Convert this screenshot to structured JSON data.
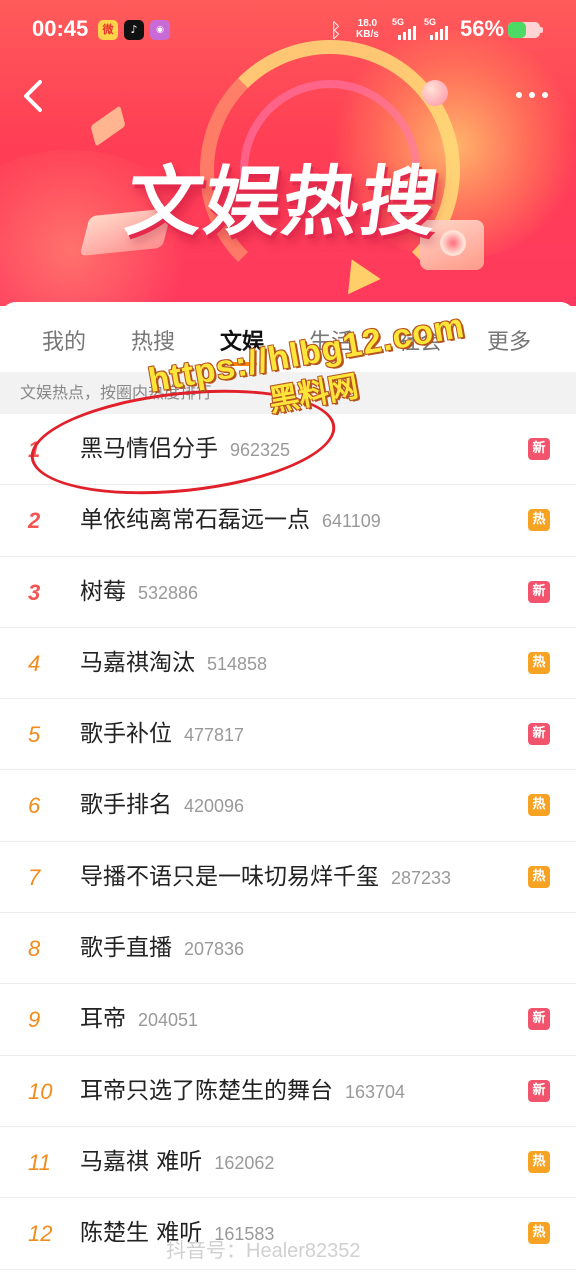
{
  "status_bar": {
    "time": "00:45",
    "apps": [
      "weibo",
      "tiktok",
      "other"
    ],
    "net_speed_value": "18.0",
    "net_speed_unit": "KB/s",
    "signal1_label": "5G",
    "signal2_label": "5G",
    "battery_percent": "56%",
    "battery_level": 0.56,
    "colors": {
      "battery_fill": "#4cd964"
    }
  },
  "header": {
    "title": "文娱热搜"
  },
  "tabs": [
    {
      "label": "我的"
    },
    {
      "label": "热搜"
    },
    {
      "label": "文娱",
      "active": true
    },
    {
      "label": "生活"
    },
    {
      "label": "社会"
    },
    {
      "label": "更多"
    }
  ],
  "notice": "文娱热点，按圈内热度排行",
  "list": [
    {
      "rank": "1",
      "title": "黑马情侣分手",
      "count": "962325",
      "badge": "新",
      "badge_type": "new"
    },
    {
      "rank": "2",
      "title": "单依纯离常石磊远一点",
      "count": "641109",
      "badge": "热",
      "badge_type": "hot"
    },
    {
      "rank": "3",
      "title": "树莓",
      "count": "532886",
      "badge": "新",
      "badge_type": "new"
    },
    {
      "rank": "4",
      "title": "马嘉祺淘汰",
      "count": "514858",
      "badge": "热",
      "badge_type": "hot"
    },
    {
      "rank": "5",
      "title": "歌手补位",
      "count": "477817",
      "badge": "新",
      "badge_type": "new"
    },
    {
      "rank": "6",
      "title": "歌手排名",
      "count": "420096",
      "badge": "热",
      "badge_type": "hot"
    },
    {
      "rank": "7",
      "title": "导播不语只是一味切易烊千玺",
      "count": "287233",
      "badge": "热",
      "badge_type": "hot"
    },
    {
      "rank": "8",
      "title": "歌手直播",
      "count": "207836",
      "badge": "",
      "badge_type": ""
    },
    {
      "rank": "9",
      "title": "耳帝",
      "count": "204051",
      "badge": "新",
      "badge_type": "new"
    },
    {
      "rank": "10",
      "title": "耳帝只选了陈楚生的舞台",
      "count": "163704",
      "badge": "新",
      "badge_type": "new"
    },
    {
      "rank": "11",
      "title": "马嘉祺 难听",
      "count": "162062",
      "badge": "热",
      "badge_type": "hot"
    },
    {
      "rank": "12",
      "title": "陈楚生 难听",
      "count": "161583",
      "badge": "热",
      "badge_type": "hot"
    }
  ],
  "overlay": {
    "watermark_url": "https://hlbg12.com",
    "watermark_name": "黑料网",
    "footer_watermark": "抖音号：Healer82352"
  }
}
